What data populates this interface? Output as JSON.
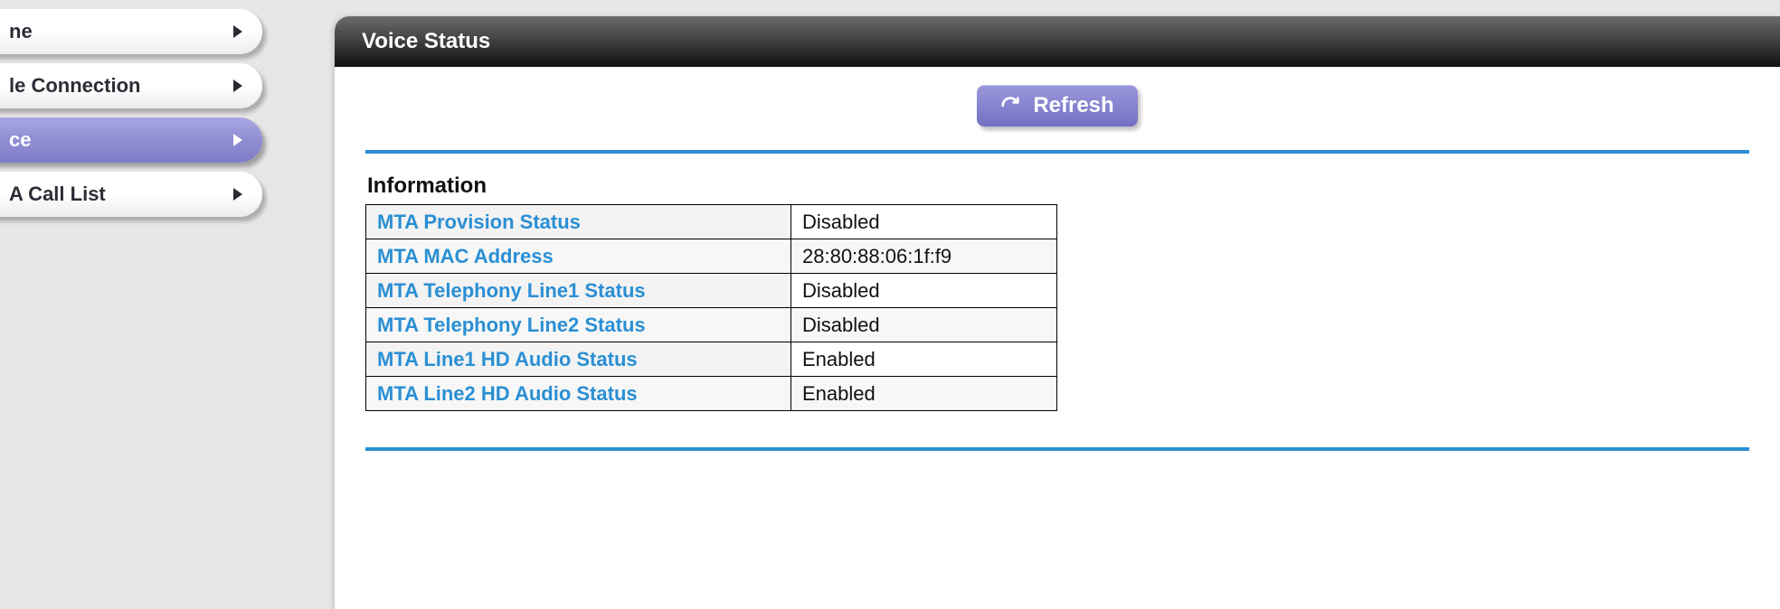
{
  "sidebar": {
    "items": [
      {
        "label": "ne",
        "active": false
      },
      {
        "label": "le Connection",
        "active": false
      },
      {
        "label": "ce",
        "active": true
      },
      {
        "label": "A Call List",
        "active": false
      }
    ]
  },
  "panel": {
    "title": "Voice Status",
    "refresh_label": "Refresh",
    "section_title": "Information",
    "rows": [
      {
        "key": "MTA Provision Status",
        "val": "Disabled"
      },
      {
        "key": "MTA MAC Address",
        "val": "28:80:88:06:1f:f9"
      },
      {
        "key": "MTA Telephony Line1 Status",
        "val": "Disabled"
      },
      {
        "key": "MTA Telephony Line2 Status",
        "val": "Disabled"
      },
      {
        "key": "MTA Line1 HD Audio Status",
        "val": "Enabled"
      },
      {
        "key": "MTA Line2 HD Audio Status",
        "val": "Enabled"
      }
    ]
  }
}
